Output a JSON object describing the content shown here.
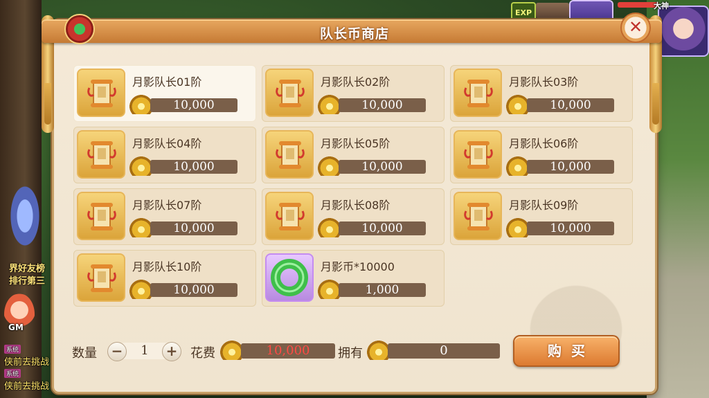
{
  "hud": {
    "exp_label": "EXP",
    "player_name": "大神"
  },
  "left_side": {
    "rank_line1": "界好友榜",
    "rank_line2": "排行第三",
    "gm_label": "GM",
    "chat": [
      {
        "tag": "系统",
        "text": "侠前去挑战"
      },
      {
        "tag": "系统",
        "text": "侠前去挑战"
      }
    ]
  },
  "shop": {
    "title": "队长币商店",
    "close_symbol": "✕",
    "items": [
      {
        "name": "月影队长01阶",
        "price": "10,000"
      },
      {
        "name": "月影队长02阶",
        "price": "10,000"
      },
      {
        "name": "月影队长03阶",
        "price": "10,000"
      },
      {
        "name": "月影队长04阶",
        "price": "10,000"
      },
      {
        "name": "月影队长05阶",
        "price": "10,000"
      },
      {
        "name": "月影队长06阶",
        "price": "10,000"
      },
      {
        "name": "月影队长07阶",
        "price": "10,000"
      },
      {
        "name": "月影队长08阶",
        "price": "10,000"
      },
      {
        "name": "月影队长09阶",
        "price": "10,000"
      },
      {
        "name": "月影队长10阶",
        "price": "10,000"
      },
      {
        "name": "月影币*10000",
        "price": "1,000"
      }
    ],
    "quantity_label": "数量",
    "quantity_value": "1",
    "minus_symbol": "−",
    "plus_symbol": "+",
    "cost_label": "花费",
    "cost_value": "10,000",
    "own_label": "拥有",
    "own_value": "0",
    "buy_label": "购买"
  },
  "colors": {
    "panel_bg": "#f4e9d7",
    "header_orange": "#d88d45",
    "price_bar": "#7a5f49",
    "cost_red": "#ff4a44"
  }
}
